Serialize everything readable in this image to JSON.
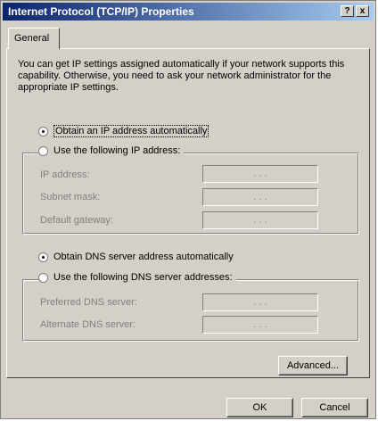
{
  "window": {
    "title": "Internet Protocol (TCP/IP) Properties",
    "help_button": "?",
    "close_button": "x"
  },
  "tabs": [
    "General"
  ],
  "intro_text": "You can get IP settings assigned automatically if your network supports this capability. Otherwise, you need to ask your network administrator for the appropriate IP settings.",
  "ip_section": {
    "obtain_auto_label": "Obtain an IP address automatically",
    "use_following_label": "Use the following IP address:",
    "selected": "obtain_auto",
    "fields": [
      {
        "label": "IP address:",
        "value": ". . ."
      },
      {
        "label": "Subnet mask:",
        "value": ". . ."
      },
      {
        "label": "Default gateway:",
        "value": ". . ."
      }
    ]
  },
  "dns_section": {
    "obtain_auto_label": "Obtain DNS server address automatically",
    "use_following_label": "Use the following DNS server addresses:",
    "selected": "obtain_auto",
    "fields": [
      {
        "label": "Preferred DNS server:",
        "value": ". . ."
      },
      {
        "label": "Alternate DNS server:",
        "value": ". . ."
      }
    ]
  },
  "buttons": {
    "advanced": "Advanced...",
    "ok": "OK",
    "cancel": "Cancel"
  }
}
